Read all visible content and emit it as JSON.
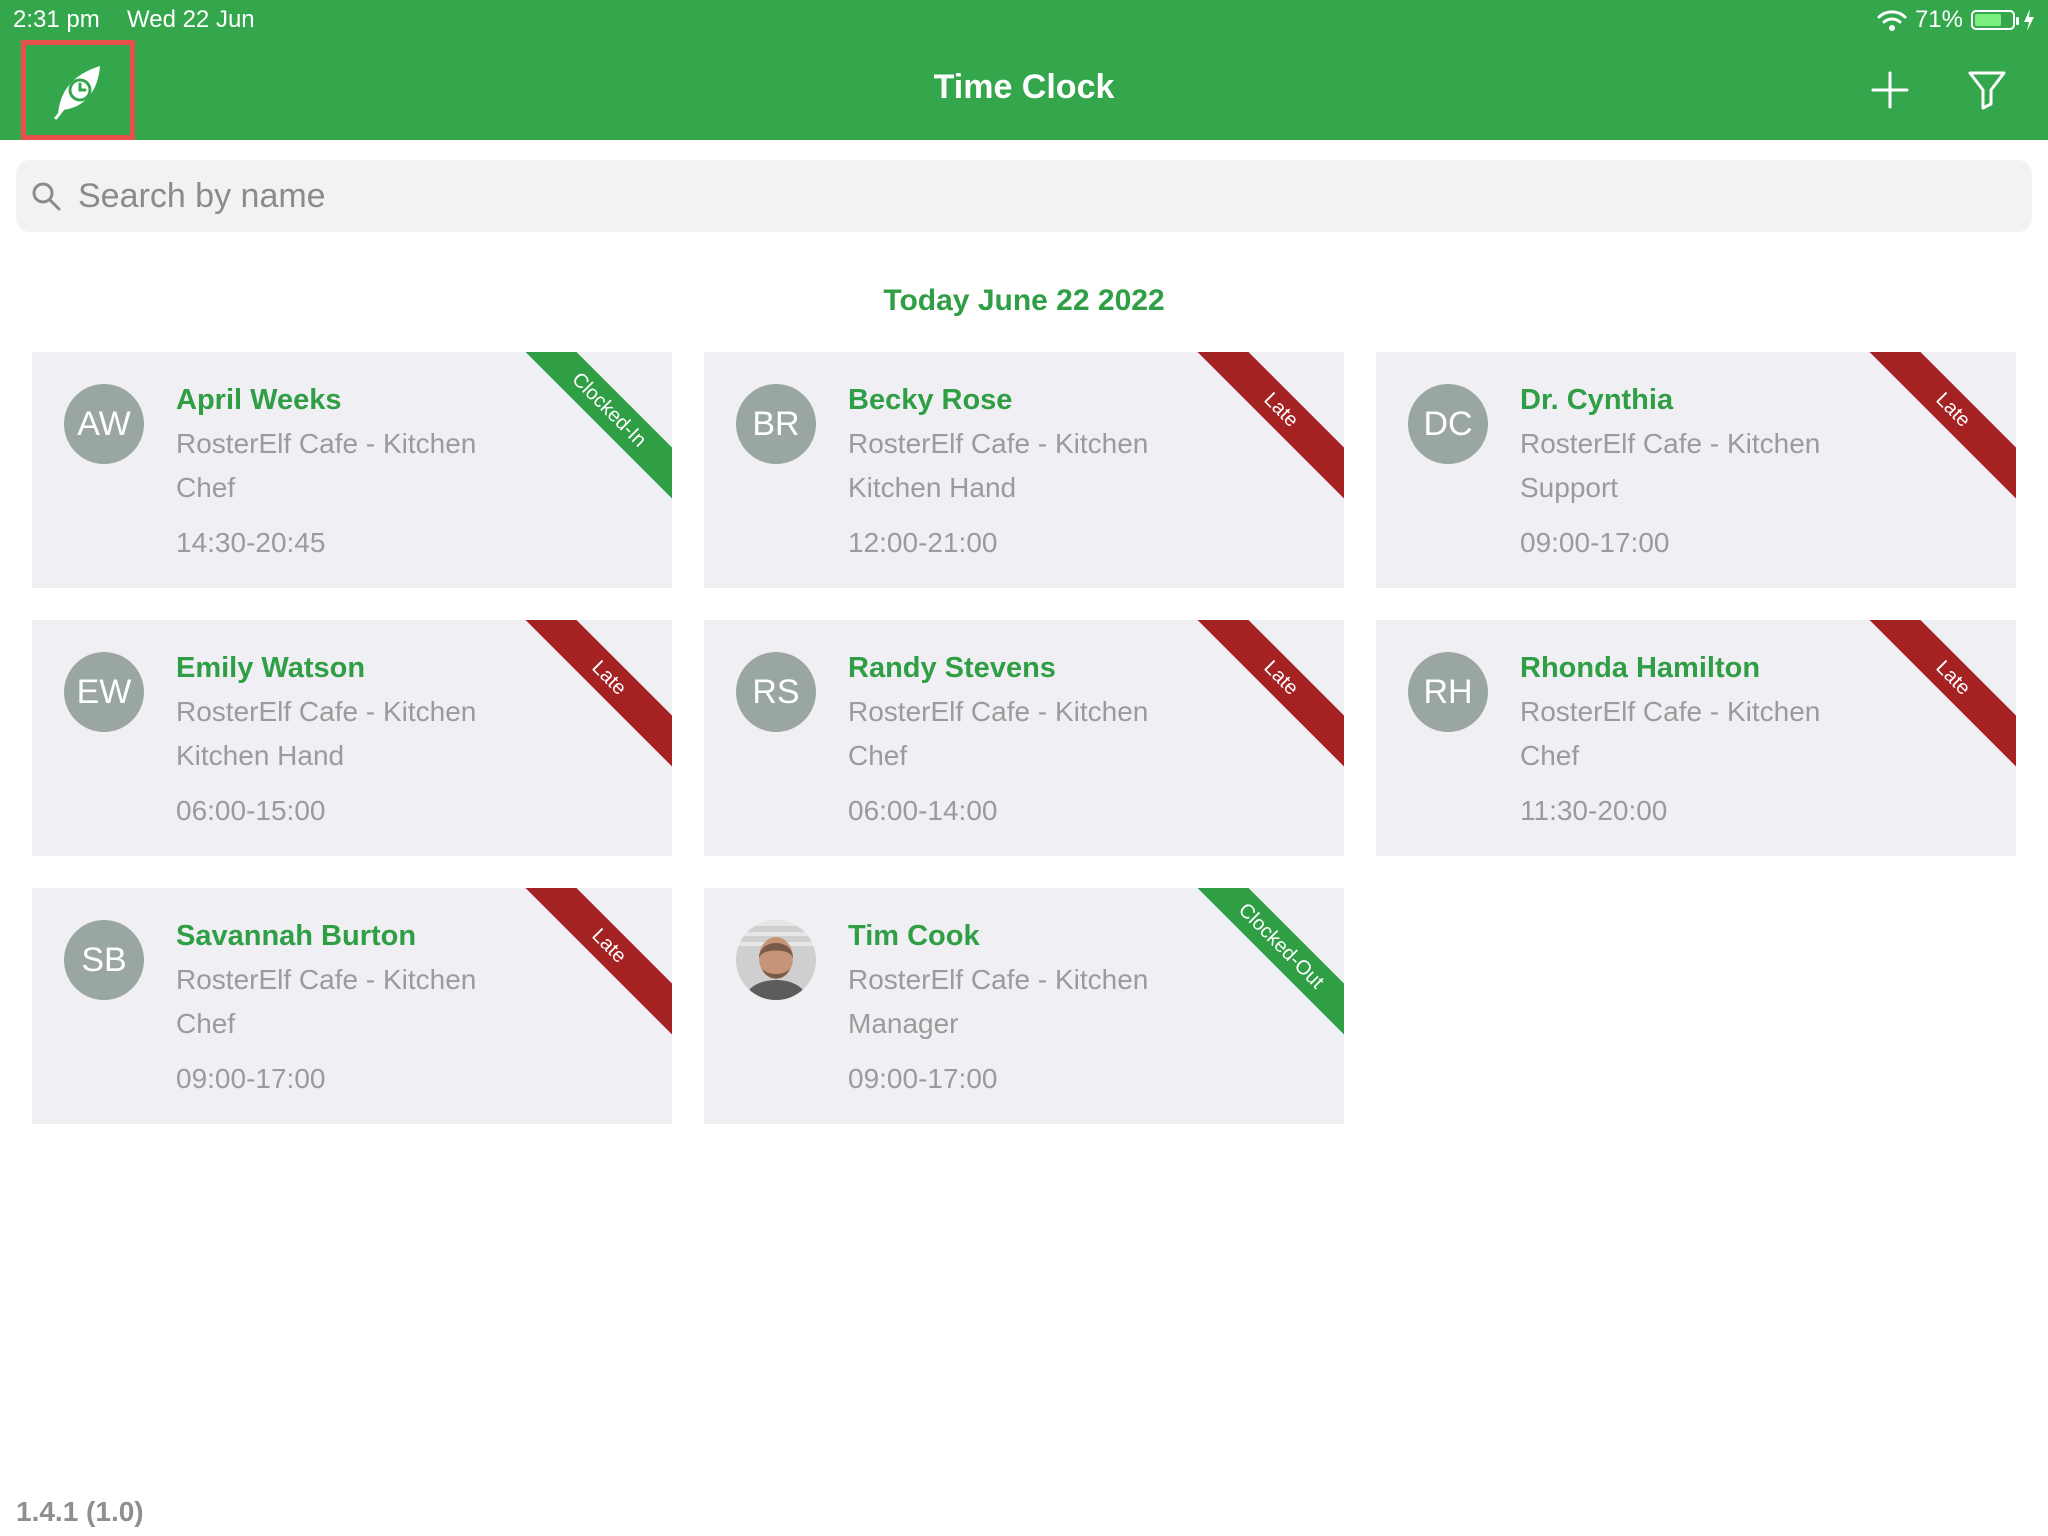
{
  "status_bar": {
    "time": "2:31 pm",
    "date": "Wed 22 Jun",
    "battery": "71%",
    "battery_level": 0.71
  },
  "header": {
    "title": "Time Clock"
  },
  "search": {
    "placeholder": "Search by name"
  },
  "date_heading": "Today June 22 2022",
  "colors": {
    "header": "#34a64c",
    "name": "#2f9e44",
    "late": "#a52222",
    "ok": "#2f9e44",
    "card": "#efeff4"
  },
  "employees": [
    {
      "initials": "AW",
      "name": "April Weeks",
      "location": "RosterElf Cafe - Kitchen",
      "role": "Chef",
      "hours": "14:30-20:45",
      "status": "Clocked-In",
      "status_type": "ok"
    },
    {
      "initials": "BR",
      "name": "Becky Rose",
      "location": "RosterElf Cafe - Kitchen",
      "role": "Kitchen Hand",
      "hours": "12:00-21:00",
      "status": "Late",
      "status_type": "late"
    },
    {
      "initials": "DC",
      "name": "Dr. Cynthia",
      "location": "RosterElf Cafe - Kitchen",
      "role": "Support",
      "hours": "09:00-17:00",
      "status": "Late",
      "status_type": "late"
    },
    {
      "initials": "EW",
      "name": "Emily Watson",
      "location": "RosterElf Cafe - Kitchen",
      "role": "Kitchen Hand",
      "hours": "06:00-15:00",
      "status": "Late",
      "status_type": "late"
    },
    {
      "initials": "RS",
      "name": "Randy Stevens",
      "location": "RosterElf Cafe - Kitchen",
      "role": "Chef",
      "hours": "06:00-14:00",
      "status": "Late",
      "status_type": "late"
    },
    {
      "initials": "RH",
      "name": "Rhonda Hamilton",
      "location": "RosterElf Cafe - Kitchen",
      "role": "Chef",
      "hours": "11:30-20:00",
      "status": "Late",
      "status_type": "late"
    },
    {
      "initials": "SB",
      "name": "Savannah Burton",
      "location": "RosterElf Cafe - Kitchen",
      "role": "Chef",
      "hours": "09:00-17:00",
      "status": "Late",
      "status_type": "late"
    },
    {
      "initials": "",
      "photo": true,
      "name": "Tim Cook",
      "location": "RosterElf Cafe - Kitchen",
      "role": "Manager",
      "hours": "09:00-17:00",
      "status": "Clocked-Out",
      "status_type": "ok"
    }
  ],
  "version": "1.4.1 (1.0)"
}
